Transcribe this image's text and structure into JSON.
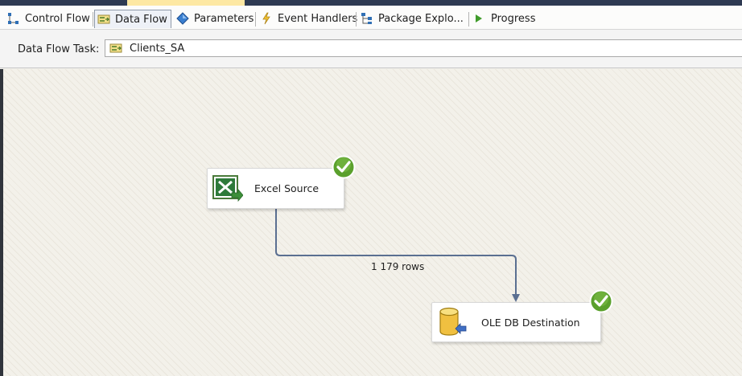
{
  "tabs": [
    {
      "label": "Control Flow",
      "icon": "control-flow-icon",
      "active": false
    },
    {
      "label": "Data Flow",
      "icon": "data-flow-icon",
      "active": true
    },
    {
      "label": "Parameters",
      "icon": "parameters-icon",
      "active": false
    },
    {
      "label": "Event Handlers",
      "icon": "event-handlers-icon",
      "active": false
    },
    {
      "label": "Package Explo...",
      "icon": "package-explorer-icon",
      "active": false
    },
    {
      "label": "Progress",
      "icon": "progress-icon",
      "active": false
    }
  ],
  "task_bar": {
    "label": "Data Flow Task:",
    "selected_task": "Clients_SA",
    "icon": "data-flow-task-icon"
  },
  "components": {
    "source": {
      "label": "Excel Source",
      "icon": "excel-icon",
      "status": "success"
    },
    "destination": {
      "label": "OLE DB Destination",
      "icon": "database-icon",
      "status": "success"
    }
  },
  "data_path": {
    "label": "1 179 rows"
  },
  "colors": {
    "accent_tab_mark": "#fde8a3",
    "path_line": "#5a6f91",
    "success_green": "#5aa02c"
  }
}
